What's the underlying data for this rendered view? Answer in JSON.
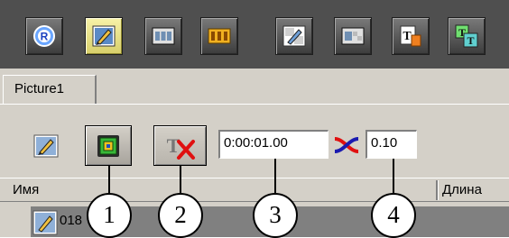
{
  "toolbar": {
    "buttons": [
      {
        "icon": "record-r-icon",
        "active": false
      },
      {
        "icon": "picture-pencil-icon",
        "active": true
      },
      {
        "icon": "film-strip-icon",
        "active": false
      },
      {
        "icon": "film-yellow-icon",
        "active": false
      },
      {
        "icon": "picture-checker-icon",
        "active": false
      },
      {
        "icon": "film-checker-icon",
        "active": false
      },
      {
        "icon": "text-page-icon",
        "active": false
      },
      {
        "icon": "text-overlay-icon",
        "active": false
      }
    ]
  },
  "tab": {
    "label": "Picture1"
  },
  "controls": {
    "time_value": "0:00:01.00",
    "speed_value": "0.10"
  },
  "table": {
    "columns": [
      "Имя",
      "Длина"
    ],
    "rows": [
      {
        "name": "018"
      }
    ]
  },
  "callouts": [
    "1",
    "2",
    "3",
    "4"
  ],
  "colors": {
    "toolbar_bg": "#4f4f4f",
    "active_button": "#e9e38f",
    "panel_bg": "#d4d0c8"
  }
}
